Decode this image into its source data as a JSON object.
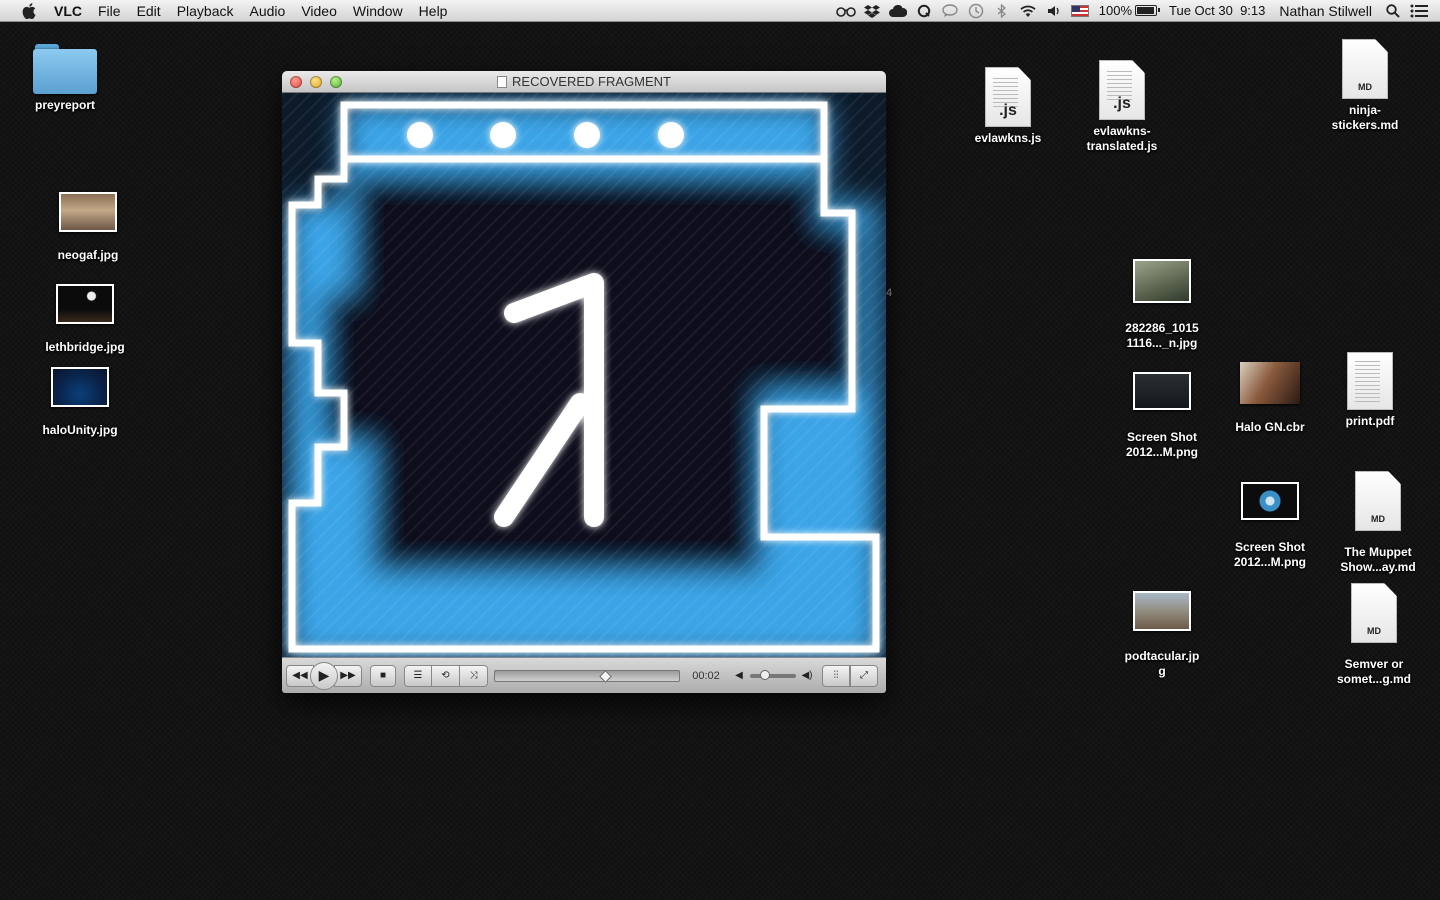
{
  "menubar": {
    "app": "VLC",
    "menus": [
      "File",
      "Edit",
      "Playback",
      "Audio",
      "Video",
      "Window",
      "Help"
    ],
    "tray_icons": [
      "glasses-icon",
      "dropbox-icon",
      "cloud-icon",
      "quicksilver-icon",
      "chat-icon",
      "time-machine-icon",
      "bluetooth-icon",
      "wifi-icon",
      "volume-icon"
    ],
    "battery_pct": "100%",
    "battery_level": 1.0,
    "clock": "Tue Oct 30  9:13",
    "user": "Nathan Stilwell"
  },
  "desktop": {
    "preyreport": "preyreport",
    "neogaf": "neogaf.jpg",
    "lethbridge": "lethbridge.jpg",
    "halounity": "haloUnity.jpg",
    "evlawkns_js": "evlawkns.js",
    "evlawkns_translated_1": "evlawkns-",
    "evlawkns_translated_2": "translated.js",
    "ninja_1": "ninja-",
    "ninja_2": "stickers.md",
    "photo282286_1": "282286_1015",
    "photo282286_2": "1116..._n.jpg",
    "screenshot_a_1": "Screen Shot",
    "screenshot_a_2": "2012...M.png",
    "halo_gn": "Halo GN.cbr",
    "print_pdf": "print.pdf",
    "screenshot_b_1": "Screen Shot",
    "screenshot_b_2": "2012...M.png",
    "muppet_1": "The Muppet",
    "muppet_2": "Show...ay.md",
    "podtacular_1": "podtacular.jp",
    "podtacular_2": "g",
    "semver_1": "Semver or",
    "semver_2": "somet...g.md",
    "badge_js": ".js",
    "badge_md": "MD",
    "stray_text": "4"
  },
  "vlc": {
    "title": "RECOVERED FRAGMENT",
    "elapsed": "00:02",
    "position_fraction": 0.6,
    "volume_fraction": 0.25
  },
  "colors": {
    "accent_blue": "#3aa5e8",
    "glow": "#ffffff"
  }
}
